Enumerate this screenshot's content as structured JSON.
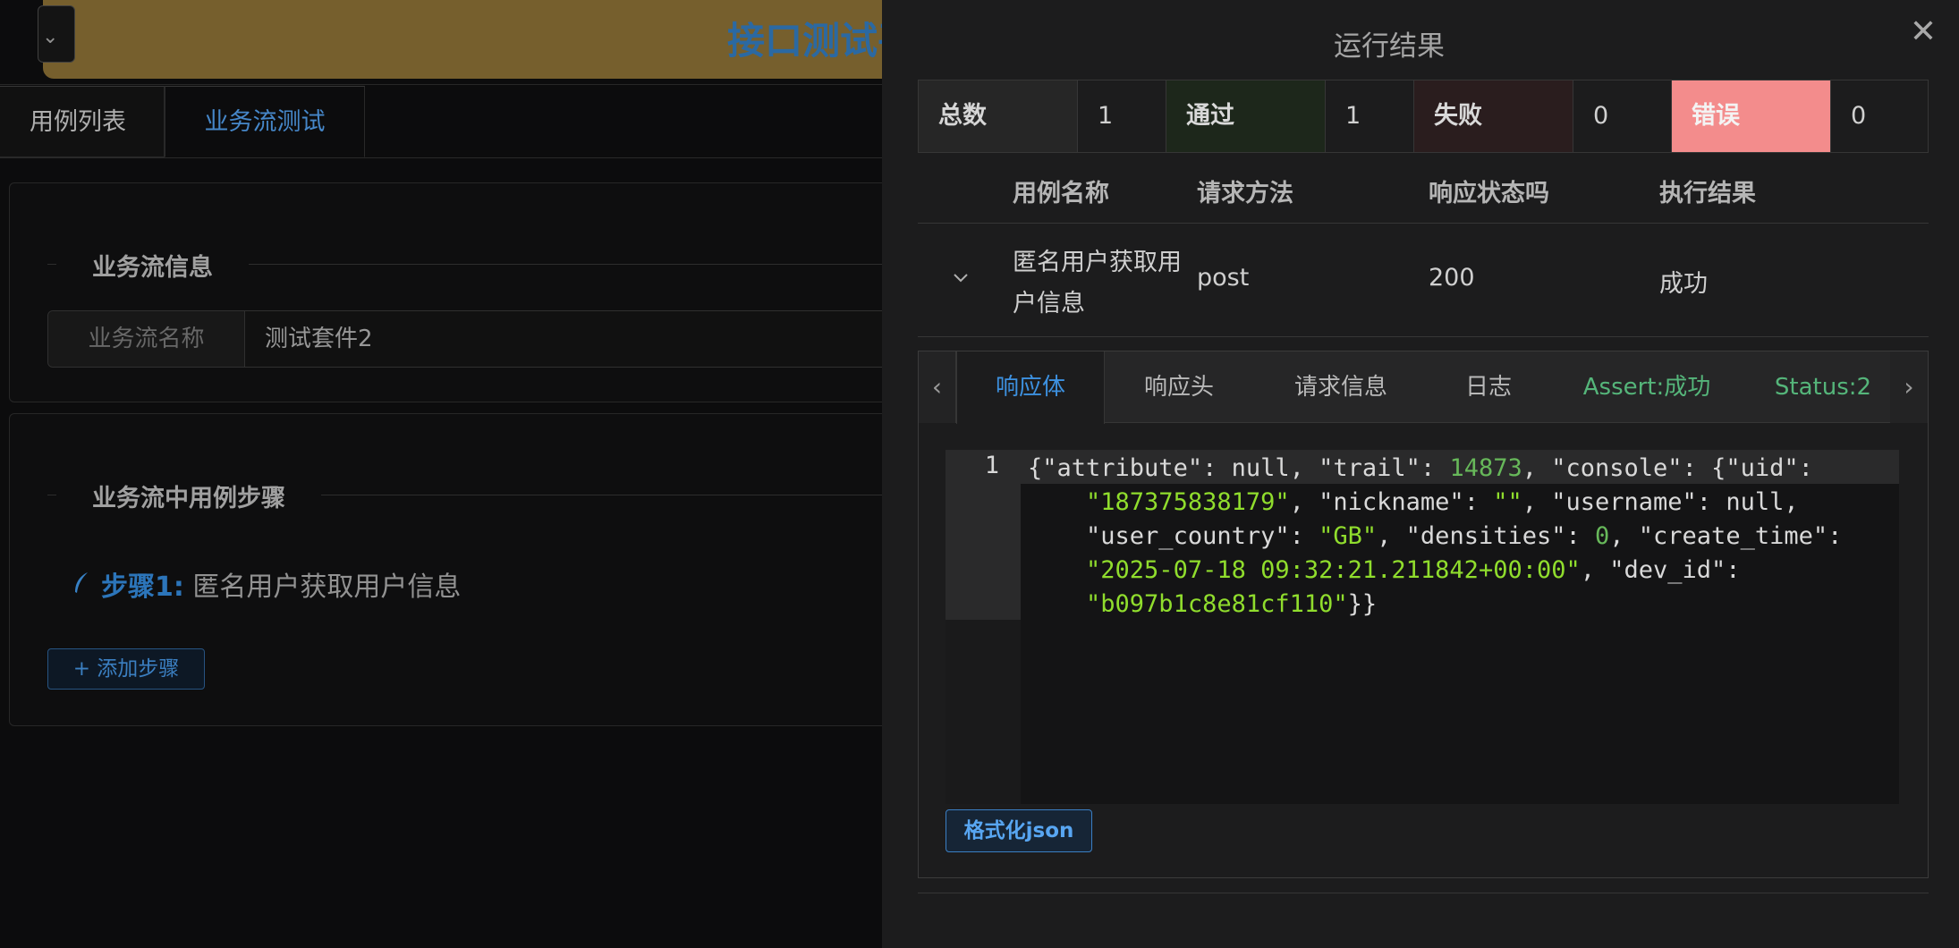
{
  "app": {
    "title": "接口测试平",
    "tabs": [
      {
        "label": "用例列表"
      },
      {
        "label": "业务流测试"
      }
    ],
    "info_section": {
      "heading": "业务流信息",
      "name_label": "业务流名称",
      "name_value": "测试套件2"
    },
    "steps_section": {
      "heading": "业务流中用例步骤",
      "steps": [
        {
          "label": "步骤1:",
          "name": "匿名用户获取用户信息"
        }
      ],
      "add_button": "+ 添加步骤"
    }
  },
  "drawer": {
    "title": "运行结果",
    "close_icon": "close-icon",
    "summary": {
      "total_label": "总数",
      "total_value": "1",
      "pass_label": "通过",
      "pass_value": "1",
      "fail_label": "失败",
      "fail_value": "0",
      "error_label": "错误",
      "error_value": "0"
    },
    "table": {
      "headers": [
        "用例名称",
        "请求方法",
        "响应状态吗",
        "执行结果"
      ],
      "rows": [
        {
          "name": "匿名用户获取用户信息",
          "method": "post",
          "status": "200",
          "result": "成功"
        }
      ]
    },
    "detail_tabs": [
      {
        "label": "响应体"
      },
      {
        "label": "响应头"
      },
      {
        "label": "请求信息"
      },
      {
        "label": "日志"
      },
      {
        "label": "Assert:成功"
      },
      {
        "label": "Status:2"
      }
    ],
    "editor": {
      "line_number": "1",
      "content": "{\"attribute\": null, \"trail\": 14873, \"console\": {\"uid\": \"187375838179\", \"nickname\": \"\", \"username\": null, \"user_country\": \"GB\", \"densities\": 0, \"create_time\": \"2025-07-18 09:32:21.211842+00:00\", \"dev_id\": \"b097b1c8e81cf110\"}}"
    },
    "format_button": "格式化json"
  }
}
